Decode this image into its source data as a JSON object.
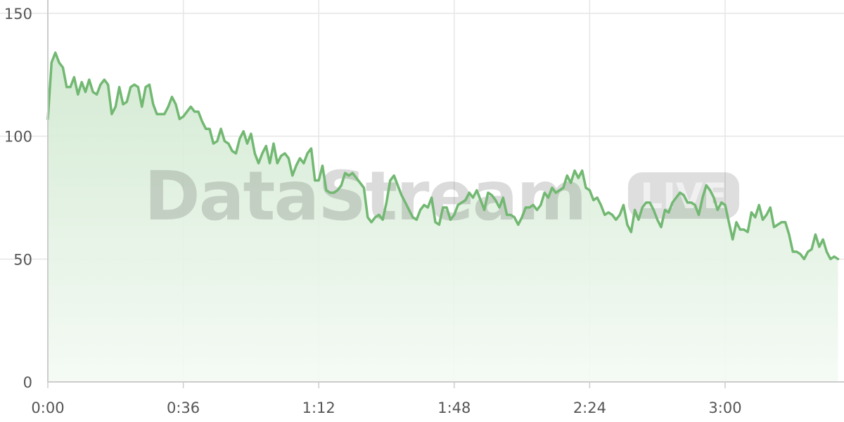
{
  "watermark": {
    "brand": "DataStream",
    "badge": "LIVE"
  },
  "colors": {
    "line": "#72b872",
    "fill_top": "#cfe8cf",
    "fill_bottom": "#f4faf4",
    "grid": "#e6e6e6",
    "axis": "#cccccc"
  },
  "chart_data": {
    "type": "area",
    "title": "",
    "xlabel": "",
    "ylabel": "",
    "grid": true,
    "legend": "none",
    "x_unit": "m:ss",
    "xlim": [
      0,
      211
    ],
    "ylim": [
      0,
      150
    ],
    "x_ticks": [
      0,
      36,
      72,
      108,
      144,
      180
    ],
    "x_tick_labels": [
      "0:00",
      "0:36",
      "1:12",
      "1:48",
      "2:24",
      "3:00"
    ],
    "y_ticks": [
      0,
      50,
      100,
      150
    ],
    "y_tick_labels": [
      "0",
      "50",
      "100",
      "150"
    ],
    "series": [
      {
        "values": [
          107,
          130,
          134,
          130,
          128,
          120,
          120,
          124,
          117,
          122,
          118,
          123,
          118,
          117,
          121,
          123,
          121,
          109,
          112,
          120,
          113,
          114,
          120,
          121,
          120,
          112,
          120,
          121,
          113,
          109,
          109,
          109,
          112,
          116,
          113,
          107,
          108,
          110,
          112,
          110,
          110,
          106,
          103,
          103,
          97,
          98,
          103,
          98,
          97,
          94,
          93,
          99,
          102,
          97,
          101,
          93,
          89,
          93,
          96,
          89,
          97,
          89,
          92,
          93,
          91,
          84,
          88,
          91,
          89,
          93,
          95,
          82,
          82,
          88,
          78,
          77,
          77,
          78,
          80,
          85,
          84,
          85,
          83,
          81,
          79,
          67,
          65,
          67,
          68,
          66,
          73,
          82,
          84,
          80,
          76,
          73,
          70,
          67,
          66,
          70,
          72,
          71,
          75,
          65,
          64,
          71,
          71,
          66,
          68,
          72,
          73,
          74,
          77,
          75,
          78,
          74,
          70,
          77,
          76,
          74,
          71,
          75,
          68,
          68,
          67,
          64,
          67,
          71,
          71,
          72,
          70,
          72,
          77,
          75,
          79,
          77,
          78,
          79,
          84,
          81,
          86,
          83,
          86,
          79,
          78,
          74,
          75,
          72,
          68,
          69,
          68,
          66,
          68,
          72,
          64,
          61,
          70,
          66,
          71,
          73,
          73,
          70,
          66,
          63,
          70,
          69,
          73,
          75,
          77,
          76,
          73,
          73,
          72,
          68,
          75,
          80,
          78,
          75,
          70,
          73,
          72,
          65,
          58,
          65,
          62,
          62,
          61,
          69,
          67,
          72,
          66,
          68,
          71,
          63,
          64,
          65,
          65,
          60,
          53,
          53,
          52,
          50,
          53,
          54,
          60,
          55,
          58,
          53,
          50,
          51,
          50
        ]
      }
    ]
  }
}
